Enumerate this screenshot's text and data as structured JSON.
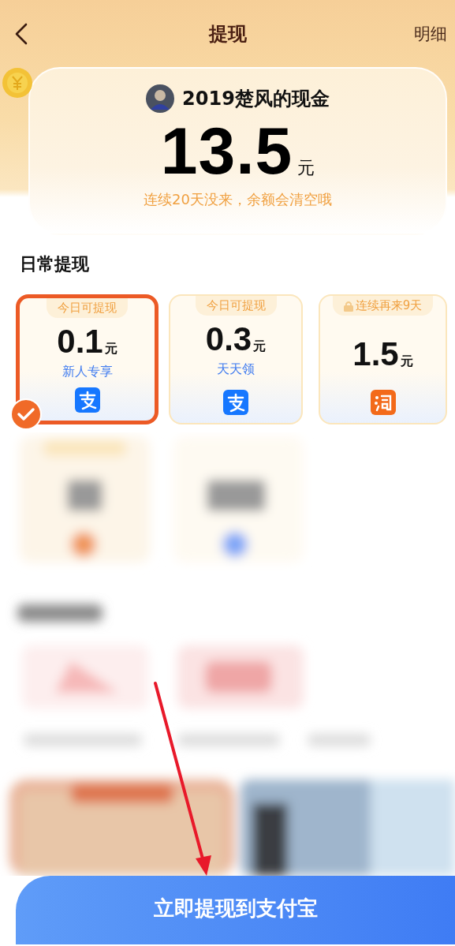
{
  "header": {
    "title": "提现",
    "detail_link": "明细"
  },
  "balance": {
    "owner": "2019楚风的现金",
    "amount": "13.5",
    "unit": "元",
    "notice": "连续20天没来，余额会清空哦"
  },
  "daily": {
    "title": "日常提现",
    "options": [
      {
        "tag": "今日可提现",
        "locked": false,
        "amount": "0.1",
        "unit": "元",
        "note": "新人专享",
        "kind": "alipay",
        "selected": true
      },
      {
        "tag": "今日可提现",
        "locked": false,
        "amount": "0.3",
        "unit": "元",
        "note": "天天领",
        "kind": "alipay",
        "selected": false
      },
      {
        "tag": "连续再来9天",
        "locked": true,
        "amount": "1.5",
        "unit": "元",
        "kind": "taobao",
        "selected": false
      }
    ]
  },
  "submit_button": "立即提现到支付宝"
}
